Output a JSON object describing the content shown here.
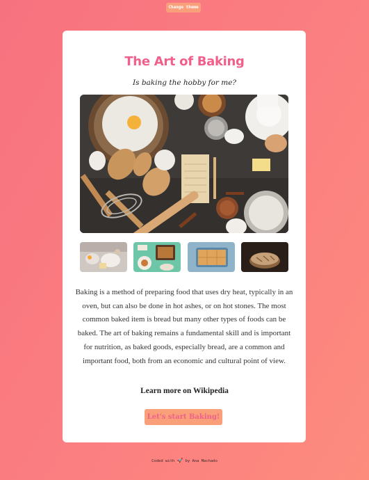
{
  "theme_button": {
    "label": "Change theme"
  },
  "card": {
    "title": "The Art of Baking",
    "subtitle": "Is baking the hobby for me?",
    "description": "Baking is a method of preparing food that uses dry heat, typically in an oven, but can also be done in hot ashes, or on hot stones. The most common baked item is bread but many other types of foods can be baked. The art of baking remains a fundamental skill and is important for nutrition, as baked goods, especially bread, are a common and important food, both from an economic and cultural point of view.",
    "learn_more": "Learn more on Wikipedia",
    "start_button": "Let's start Baking!"
  },
  "footer": {
    "prefix": "Coded with",
    "icon": "rocket-icon",
    "suffix": "by Ana Machado"
  },
  "colors": {
    "background_start": "#f7727f",
    "background_end": "#fd8c7d",
    "accent_pink": "#f0608a",
    "button_orange": "#f9a07b"
  }
}
